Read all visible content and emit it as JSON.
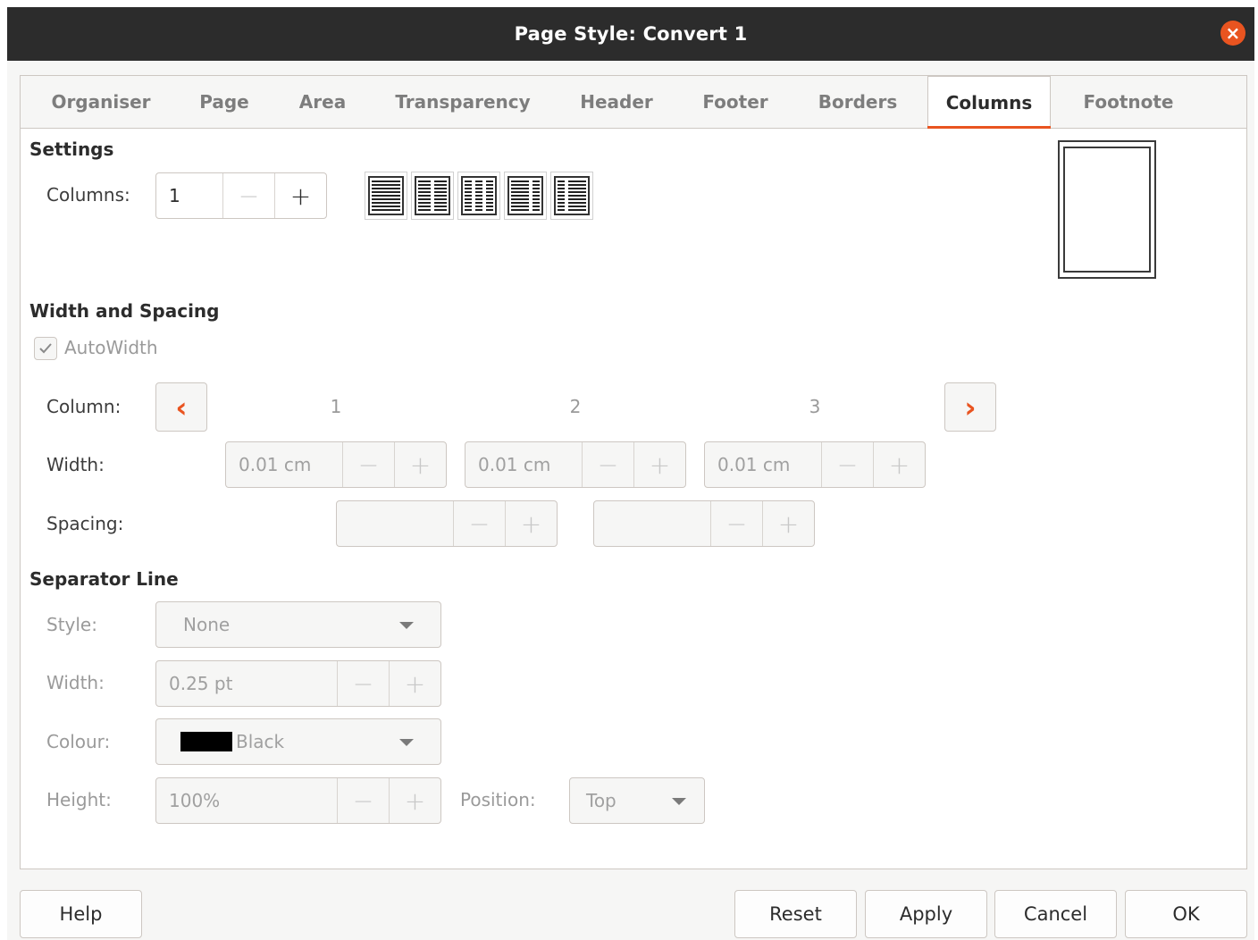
{
  "window": {
    "title": "Page Style: Convert 1"
  },
  "tabs": [
    {
      "label": "Organiser"
    },
    {
      "label": "Page"
    },
    {
      "label": "Area"
    },
    {
      "label": "Transparency"
    },
    {
      "label": "Header"
    },
    {
      "label": "Footer"
    },
    {
      "label": "Borders"
    },
    {
      "label": "Columns",
      "active": true
    },
    {
      "label": "Footnote"
    }
  ],
  "settings": {
    "title": "Settings",
    "columns_label": "Columns:",
    "columns_value": "1",
    "presets": [
      "1 column",
      "2 columns",
      "3 columns",
      "2 columns left larger",
      "2 columns right larger"
    ]
  },
  "width_spacing": {
    "title": "Width and Spacing",
    "autowidth_label": "AutoWidth",
    "autowidth_checked": true,
    "column_label": "Column:",
    "column_numbers": [
      "1",
      "2",
      "3"
    ],
    "width_label": "Width:",
    "widths": [
      "0.01 cm",
      "0.01 cm",
      "0.01 cm"
    ],
    "spacing_label": "Spacing:",
    "spacings": [
      "",
      ""
    ]
  },
  "separator": {
    "title": "Separator Line",
    "style_label": "Style:",
    "style_value": "None",
    "width_label": "Width:",
    "width_value": "0.25 pt",
    "colour_label": "Colour:",
    "colour_value": "Black",
    "colour_swatch": "#000000",
    "height_label": "Height:",
    "height_value": "100%",
    "position_label": "Position:",
    "position_value": "Top"
  },
  "buttons": {
    "help": "Help",
    "reset": "Reset",
    "apply": "Apply",
    "cancel": "Cancel",
    "ok": "OK"
  },
  "colors": {
    "accent": "#e95420",
    "titlebar": "#2c2c2c"
  }
}
